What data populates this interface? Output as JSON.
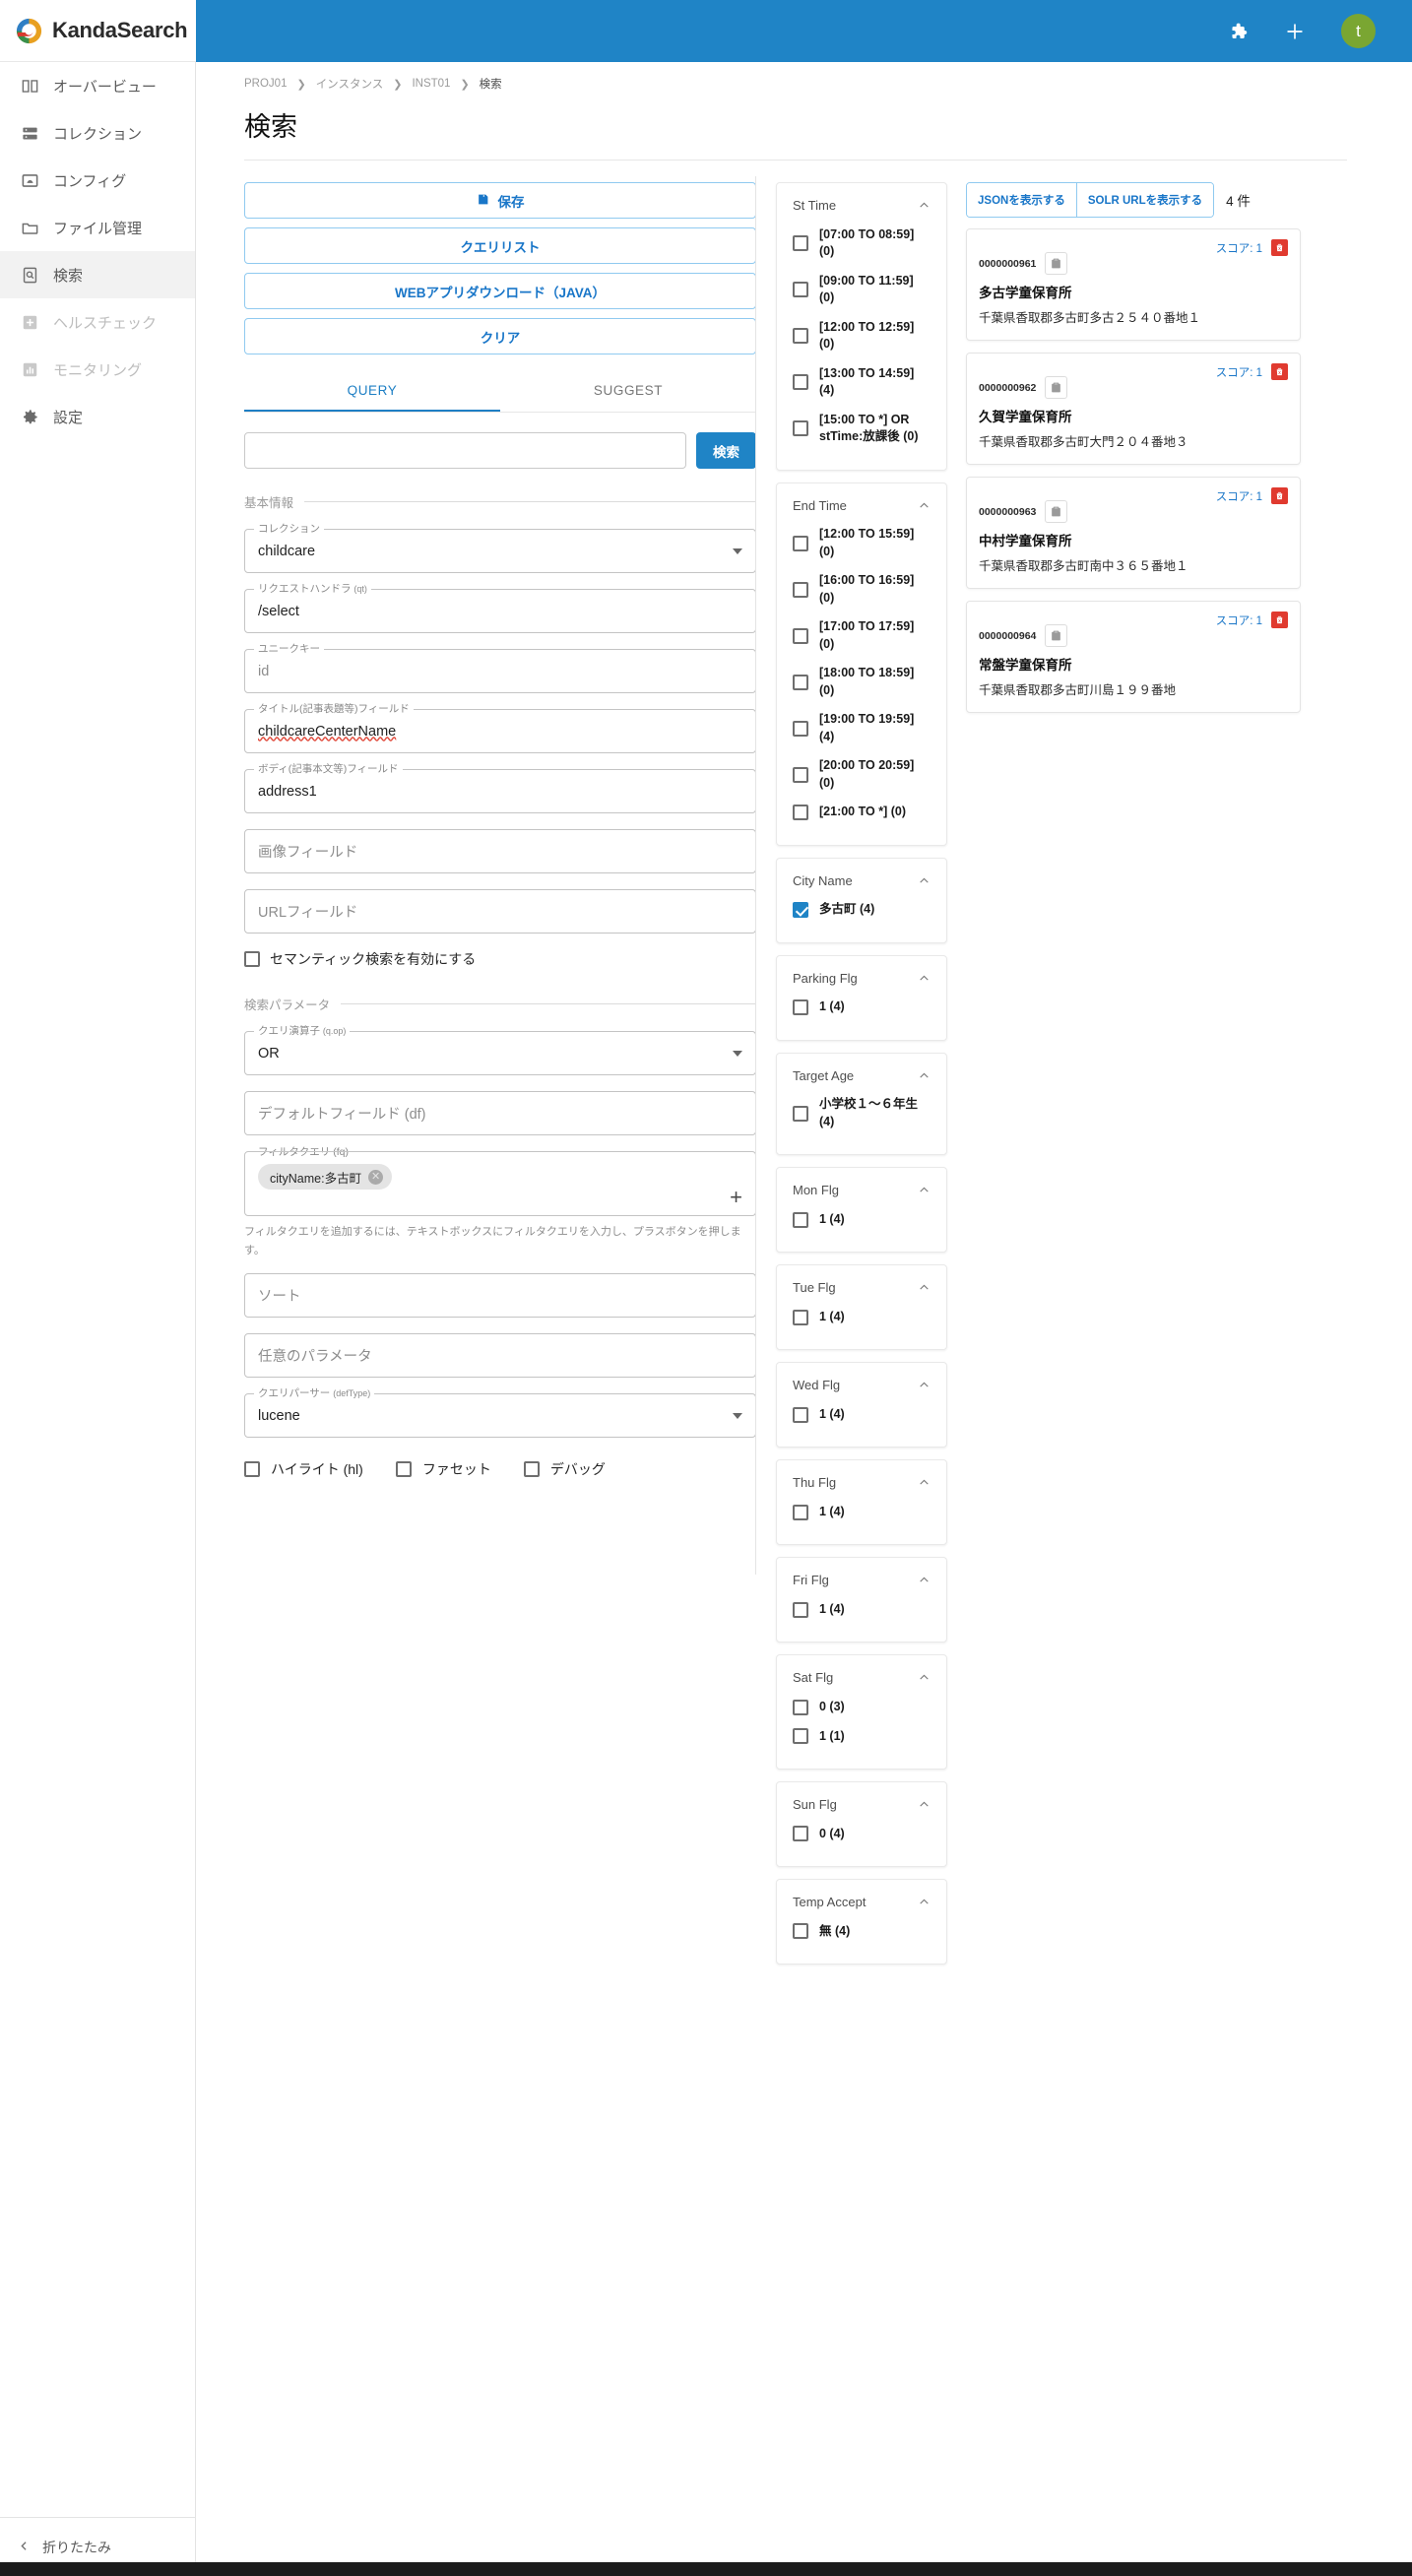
{
  "brand": {
    "name": "KandaSearch",
    "logo_icon": "swirl-logo-icon"
  },
  "topbar": {
    "extension_icon": "puzzle-piece-icon",
    "add_icon": "plus-icon",
    "avatar_initial": "t",
    "avatar_color": "#7aa632",
    "bar_color": "#1f84c6"
  },
  "sidebar": {
    "items": [
      {
        "label": "オーバービュー",
        "icon": "book-icon",
        "active": false,
        "disabled": false
      },
      {
        "label": "コレクション",
        "icon": "server-icon",
        "active": false,
        "disabled": false
      },
      {
        "label": "コンフィグ",
        "icon": "config-image-icon",
        "active": false,
        "disabled": false
      },
      {
        "label": "ファイル管理",
        "icon": "folder-icon",
        "active": false,
        "disabled": false
      },
      {
        "label": "検索",
        "icon": "search-doc-icon",
        "active": true,
        "disabled": false
      },
      {
        "label": "ヘルスチェック",
        "icon": "health-plus-icon",
        "active": false,
        "disabled": true
      },
      {
        "label": "モニタリング",
        "icon": "bar-chart-icon",
        "active": false,
        "disabled": true
      },
      {
        "label": "設定",
        "icon": "gear-icon",
        "active": false,
        "disabled": false
      }
    ],
    "collapse_label": "折りたたみ",
    "collapse_icon": "chevron-left-icon"
  },
  "breadcrumb": {
    "items": [
      "PROJ01",
      "インスタンス",
      "INST01",
      "検索"
    ],
    "separator_icon": "chevron-right-icon"
  },
  "page": {
    "title": "検索"
  },
  "actions": {
    "save": {
      "label": "保存",
      "icon": "save-floppy-icon"
    },
    "query_list": {
      "label": "クエリリスト"
    },
    "webapp_download": {
      "label": "WEBアプリダウンロード（JAVA）"
    },
    "clear": {
      "label": "クリア"
    }
  },
  "tabs": [
    {
      "label": "QUERY",
      "active": true
    },
    {
      "label": "SUGGEST",
      "active": false
    }
  ],
  "query": {
    "input_value": "",
    "input_placeholder": "",
    "search_button": "検索"
  },
  "basic_section": {
    "legend": "基本情報",
    "fields": [
      {
        "label": "コレクション",
        "suffix": "",
        "value": "childcare",
        "placeholder": "",
        "type": "select"
      },
      {
        "label": "リクエストハンドラ",
        "suffix": "(qt)",
        "value": "/select",
        "placeholder": "",
        "type": "text"
      },
      {
        "label": "ユニークキー",
        "suffix": "",
        "value": "",
        "placeholder": "id",
        "type": "text"
      },
      {
        "label": "タイトル(記事表題等)フィールド",
        "suffix": "",
        "value": "childcareCenterName",
        "placeholder": "",
        "type": "text",
        "spellcheck_underline": true
      },
      {
        "label": "ボディ(記事本文等)フィールド",
        "suffix": "",
        "value": "address1",
        "placeholder": "",
        "type": "text"
      }
    ],
    "plain_fields": [
      {
        "placeholder": "画像フィールド"
      },
      {
        "placeholder": "URLフィールド"
      }
    ],
    "semantic_checkbox": {
      "label": "セマンティック検索を有効にする",
      "checked": false
    }
  },
  "param_section": {
    "legend": "検索パラメータ",
    "qop": {
      "label": "クエリ演算子",
      "suffix": "(q.op)",
      "value": "OR",
      "type": "select"
    },
    "df": {
      "placeholder": "デフォルトフィールド (df)"
    },
    "fq": {
      "label": "フィルタクエリ",
      "suffix": "(fq)",
      "chips": [
        {
          "text": "cityName:多古町",
          "remove_icon": "chip-close-icon"
        }
      ],
      "add_icon": "plus-icon",
      "help": "フィルタクエリを追加するには、テキストボックスにフィルタクエリを入力し、プラスボタンを押します。"
    },
    "sort": {
      "placeholder": "ソート"
    },
    "optional": {
      "placeholder": "任意のパラメータ"
    },
    "deftype": {
      "label": "クエリパーサー",
      "suffix": "(defType)",
      "value": "lucene",
      "type": "select"
    },
    "flags": [
      {
        "label": "ハイライト (hl)",
        "checked": false
      },
      {
        "label": "ファセット",
        "checked": false
      },
      {
        "label": "デバッグ",
        "checked": false
      }
    ]
  },
  "facets": [
    {
      "title": "St Time",
      "collapse_icon": "chevron-up-icon",
      "options": [
        {
          "label": "[07:00 TO 08:59] (0)",
          "checked": false
        },
        {
          "label": "[09:00 TO 11:59] (0)",
          "checked": false
        },
        {
          "label": "[12:00 TO 12:59] (0)",
          "checked": false
        },
        {
          "label": "[13:00 TO 14:59] (4)",
          "checked": false
        },
        {
          "label": "[15:00 TO *] OR stTime:放課後 (0)",
          "checked": false
        }
      ]
    },
    {
      "title": "End Time",
      "collapse_icon": "chevron-up-icon",
      "options": [
        {
          "label": "[12:00 TO 15:59] (0)",
          "checked": false
        },
        {
          "label": "[16:00 TO 16:59] (0)",
          "checked": false
        },
        {
          "label": "[17:00 TO 17:59] (0)",
          "checked": false
        },
        {
          "label": "[18:00 TO 18:59] (0)",
          "checked": false
        },
        {
          "label": "[19:00 TO 19:59] (4)",
          "checked": false
        },
        {
          "label": "[20:00 TO 20:59] (0)",
          "checked": false
        },
        {
          "label": "[21:00 TO *] (0)",
          "checked": false
        }
      ]
    },
    {
      "title": "City Name",
      "collapse_icon": "chevron-up-icon",
      "options": [
        {
          "label": "多古町 (4)",
          "checked": true
        }
      ]
    },
    {
      "title": "Parking Flg",
      "collapse_icon": "chevron-up-icon",
      "options": [
        {
          "label": "1 (4)",
          "checked": false
        }
      ]
    },
    {
      "title": "Target Age",
      "collapse_icon": "chevron-up-icon",
      "options": [
        {
          "label": "小学校１〜６年生 (4)",
          "checked": false
        }
      ]
    },
    {
      "title": "Mon Flg",
      "collapse_icon": "chevron-up-icon",
      "options": [
        {
          "label": "1 (4)",
          "checked": false
        }
      ]
    },
    {
      "title": "Tue Flg",
      "collapse_icon": "chevron-up-icon",
      "options": [
        {
          "label": "1 (4)",
          "checked": false
        }
      ]
    },
    {
      "title": "Wed Flg",
      "collapse_icon": "chevron-up-icon",
      "options": [
        {
          "label": "1 (4)",
          "checked": false
        }
      ]
    },
    {
      "title": "Thu Flg",
      "collapse_icon": "chevron-up-icon",
      "options": [
        {
          "label": "1 (4)",
          "checked": false
        }
      ]
    },
    {
      "title": "Fri Flg",
      "collapse_icon": "chevron-up-icon",
      "options": [
        {
          "label": "1 (4)",
          "checked": false
        }
      ]
    },
    {
      "title": "Sat Flg",
      "collapse_icon": "chevron-up-icon",
      "options": [
        {
          "label": "0 (3)",
          "checked": false
        },
        {
          "label": "1 (1)",
          "checked": false
        }
      ]
    },
    {
      "title": "Sun Flg",
      "collapse_icon": "chevron-up-icon",
      "options": [
        {
          "label": "0 (4)",
          "checked": false
        }
      ]
    },
    {
      "title": "Temp Accept",
      "collapse_icon": "chevron-up-icon",
      "options": [
        {
          "label": "無 (4)",
          "checked": false
        }
      ]
    }
  ],
  "results": {
    "show_json_label": "JSONを表示する",
    "show_solr_url_label": "SOLR URLを表示する",
    "count_label": "4 件",
    "score_prefix": "スコア: ",
    "copy_icon": "clipboard-icon",
    "delete_icon": "trash-icon",
    "items": [
      {
        "id": "0000000961",
        "score": "1",
        "name": "多古学童保育所",
        "address": "千葉県香取郡多古町多古２５４０番地１"
      },
      {
        "id": "0000000962",
        "score": "1",
        "name": "久賀学童保育所",
        "address": "千葉県香取郡多古町大門２０４番地３"
      },
      {
        "id": "0000000963",
        "score": "1",
        "name": "中村学童保育所",
        "address": "千葉県香取郡多古町南中３６５番地１"
      },
      {
        "id": "0000000964",
        "score": "1",
        "name": "常盤学童保育所",
        "address": "千葉県香取郡多古町川島１９９番地"
      }
    ]
  }
}
